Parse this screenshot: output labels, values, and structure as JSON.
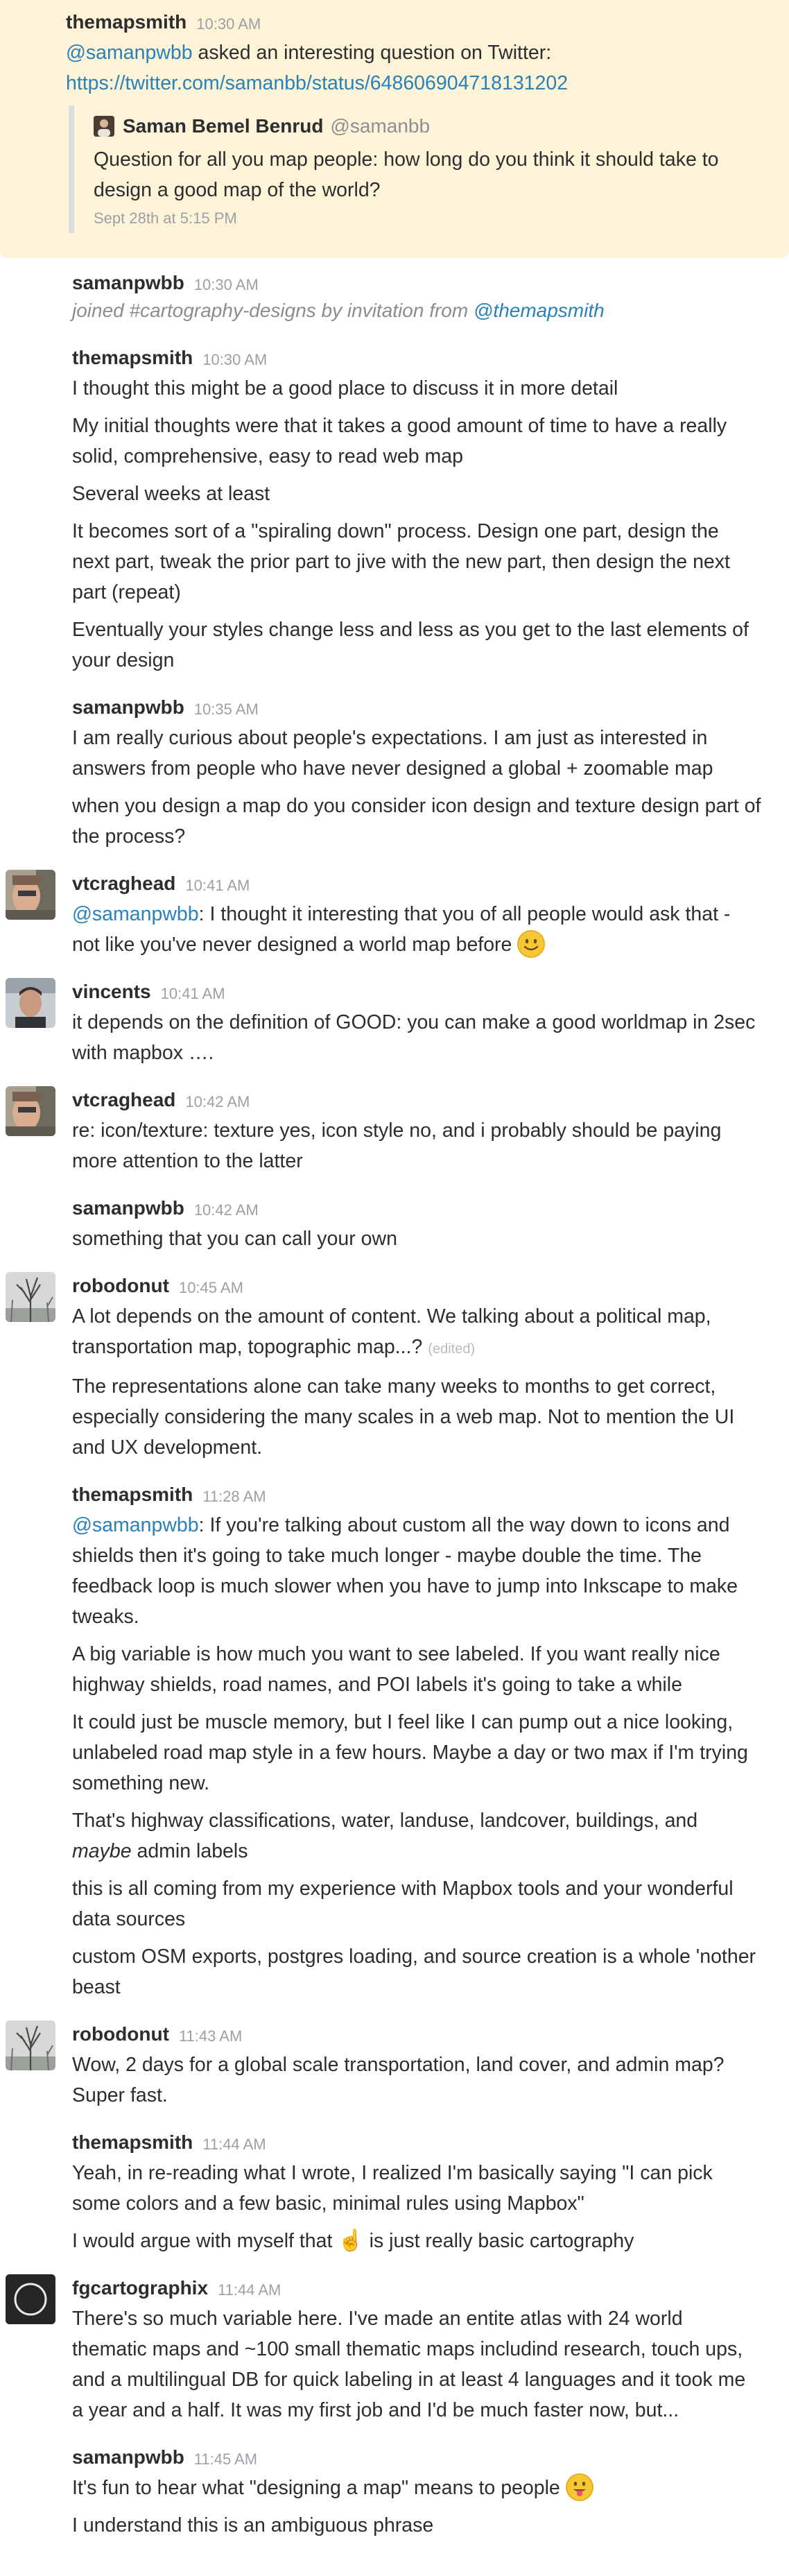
{
  "messages": {
    "m0": {
      "author": "themapsmith",
      "time": "10:30 AM",
      "l0_mention": "@samanpwbb",
      "l0_text": " asked an interesting question on Twitter:",
      "l1_link": "https://twitter.com/samanbb/status/648606904718131202",
      "quote": {
        "name": "Saman Bemel Benrud",
        "handle": "@samanbb",
        "text": "Question for all you map people: how long do you think it should take to design a good map of the world?",
        "date": "Sept 28th at 5:15 PM"
      }
    },
    "m1": {
      "author": "samanpwbb",
      "time": "10:30 AM",
      "sys_text": "joined #cartography-designs by invitation from ",
      "sys_mention": "@themapsmith"
    },
    "m2": {
      "author": "themapsmith",
      "time": "10:30 AM",
      "l0": "I thought this might be a good place to discuss it in more detail",
      "l1": "My initial thoughts were that it takes a good amount of time to have a really solid, comprehensive, easy to read web map",
      "l2": "Several weeks at least",
      "l3": "It becomes sort of a \"spiraling down\" process. Design one part, design the next part, tweak the prior part to jive with the new part, then design the next part (repeat)",
      "l4": "Eventually your styles change less and less as you get to the last elements of your design"
    },
    "m3": {
      "author": "samanpwbb",
      "time": "10:35 AM",
      "l0": "I am really curious about people's expectations. I am just as interested in answers from people who have never designed a global + zoomable map",
      "l1": "when you design a map do you consider icon design and texture design part of the process?"
    },
    "m4": {
      "author": "vtcraghead",
      "time": "10:41 AM",
      "l0_mention": "@samanpwbb",
      "l0_text": ": I thought it interesting that you of all people would ask that - not like you've never designed a world map before "
    },
    "m5": {
      "author": "vincents",
      "time": "10:41 AM",
      "l0": "it depends on the definition of GOOD: you can make a good worldmap in 2sec with mapbox …."
    },
    "m6": {
      "author": "vtcraghead",
      "time": "10:42 AM",
      "l0": "re: icon/texture: texture yes, icon style no, and i probably should be paying more attention to the latter"
    },
    "m7": {
      "author": "samanpwbb",
      "time": "10:42 AM",
      "l0": "something that you can call your own"
    },
    "m8": {
      "author": "robodonut",
      "time": "10:45 AM",
      "l0": "A lot depends on the amount of content. We talking about a political map, transportation  map, topographic map...? ",
      "l0_edited": "(edited)",
      "l1": "The representations alone can take many weeks to months to get correct, especially considering the many scales in a web map. Not to mention the UI and UX development."
    },
    "m9": {
      "author": "themapsmith",
      "time": "11:28 AM",
      "l0_mention": "@samanpwbb",
      "l0_text": ": If you're talking about custom all the way down  to icons and shields then it's going to take much longer - maybe double the time. The feedback loop is much slower when you have to jump into Inkscape to make tweaks.",
      "l1": "A big variable is how much you want to see labeled. If you want really nice highway shields, road names, and POI labels it's going to take a while",
      "l2": "It could just be muscle memory, but I feel like I can pump out a nice looking, unlabeled road map style in a few hours.  Maybe a day or two max if I'm trying something new.",
      "l3_a": "That's highway classifications, water, landuse, landcover, buildings, and ",
      "l3_em": "maybe",
      "l3_b": " admin labels",
      "l4": "this is all coming from my experience with Mapbox tools and your wonderful data sources",
      "l5": "custom OSM exports, postgres loading, and source creation is a whole 'nother beast"
    },
    "m10": {
      "author": "robodonut",
      "time": "11:43 AM",
      "l0": "Wow, 2 days for a global scale transportation, land cover, and admin map? Super fast."
    },
    "m11": {
      "author": "themapsmith",
      "time": "11:44 AM",
      "l0": "Yeah, in re-reading what I wrote, I realized I'm basically saying \"I can pick some colors and a few basic, minimal rules using Mapbox\"",
      "l1_a": "I would argue with myself that ",
      "l1_emoji": "☝",
      "l1_b": "  is just really basic cartography"
    },
    "m12": {
      "author": "fgcartographix",
      "time": "11:44 AM",
      "l0": "There's so much variable here. I've made an entite atlas with 24 world thematic maps and ~100 small thematic maps includind research, touch ups, and a multilingual DB for quick labeling in at least 4 languages and it took me a year and a half. It was my first job and I'd be much faster now, but..."
    },
    "m13": {
      "author": "samanpwbb",
      "time": "11:45 AM",
      "l0": "It's fun to hear what \"designing a map\" means to people ",
      "l1": "I understand this is an ambiguous phrase"
    }
  },
  "colors": {
    "mention": "#2a80b9",
    "highlight": "#fdf4d8",
    "timestamp": "#9e9ea6"
  },
  "icons": {
    "smile": "smiley-emoji",
    "tongue": "tongue-emoji",
    "point_up": "point-up-emoji"
  }
}
